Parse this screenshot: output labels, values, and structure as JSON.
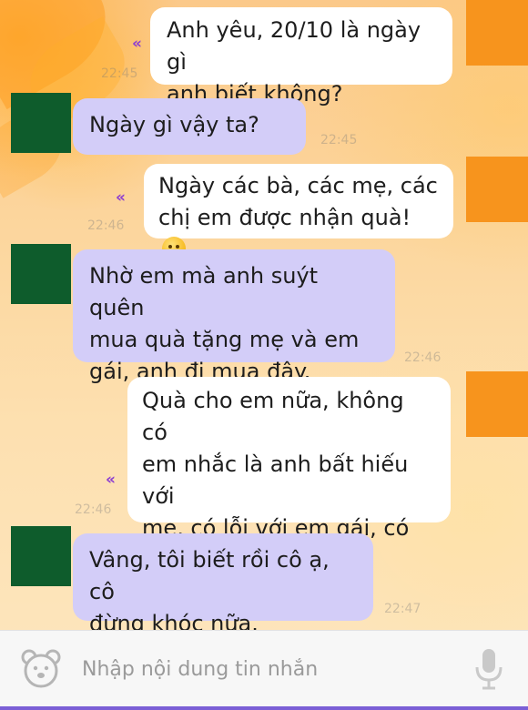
{
  "messages": [
    {
      "side": "me",
      "text": "Anh yêu, 20/10 là ngày gì\nanh biết không?",
      "time": "22:45",
      "receipt": "«"
    },
    {
      "side": "other",
      "text": "Ngày gì vậy ta?",
      "time": "22:45"
    },
    {
      "side": "me",
      "text": "Ngày các bà, các mẹ, các\nchị em được nhận quà! ",
      "time": "22:46",
      "receipt": "«",
      "emoji": "hug-emoji-icon"
    },
    {
      "side": "other",
      "text": "Nhờ em mà anh suýt quên\nmua quà tặng mẹ và em\ngái, anh đi mua đây.",
      "time": "22:46"
    },
    {
      "side": "me",
      "text": "Quà cho em nữa, không có\nem nhắc là anh bất hiếu với\nmẹ, có lỗi với em gái, có lỗi\nvới bạn gái nữa.",
      "time": "22:46",
      "receipt": "«"
    },
    {
      "side": "other",
      "text": "Vâng, tôi biết rồi cô ạ, cô\nđừng khóc nữa.",
      "time": "22:47"
    }
  ],
  "input": {
    "placeholder": "Nhập nội dung tin nhắn",
    "value": ""
  },
  "icons": {
    "sticker": "sticker-face-icon",
    "mic": "microphone-icon",
    "receipt": "double-chevron-icon"
  },
  "colors": {
    "my_avatar": "#f7941d",
    "other_avatar": "#0e5c2c",
    "my_bubble": "#ffffff",
    "other_bubble": "#d3cdf8",
    "receipt": "#8e3fd0",
    "bottom_accent": "#7b5fd6"
  }
}
